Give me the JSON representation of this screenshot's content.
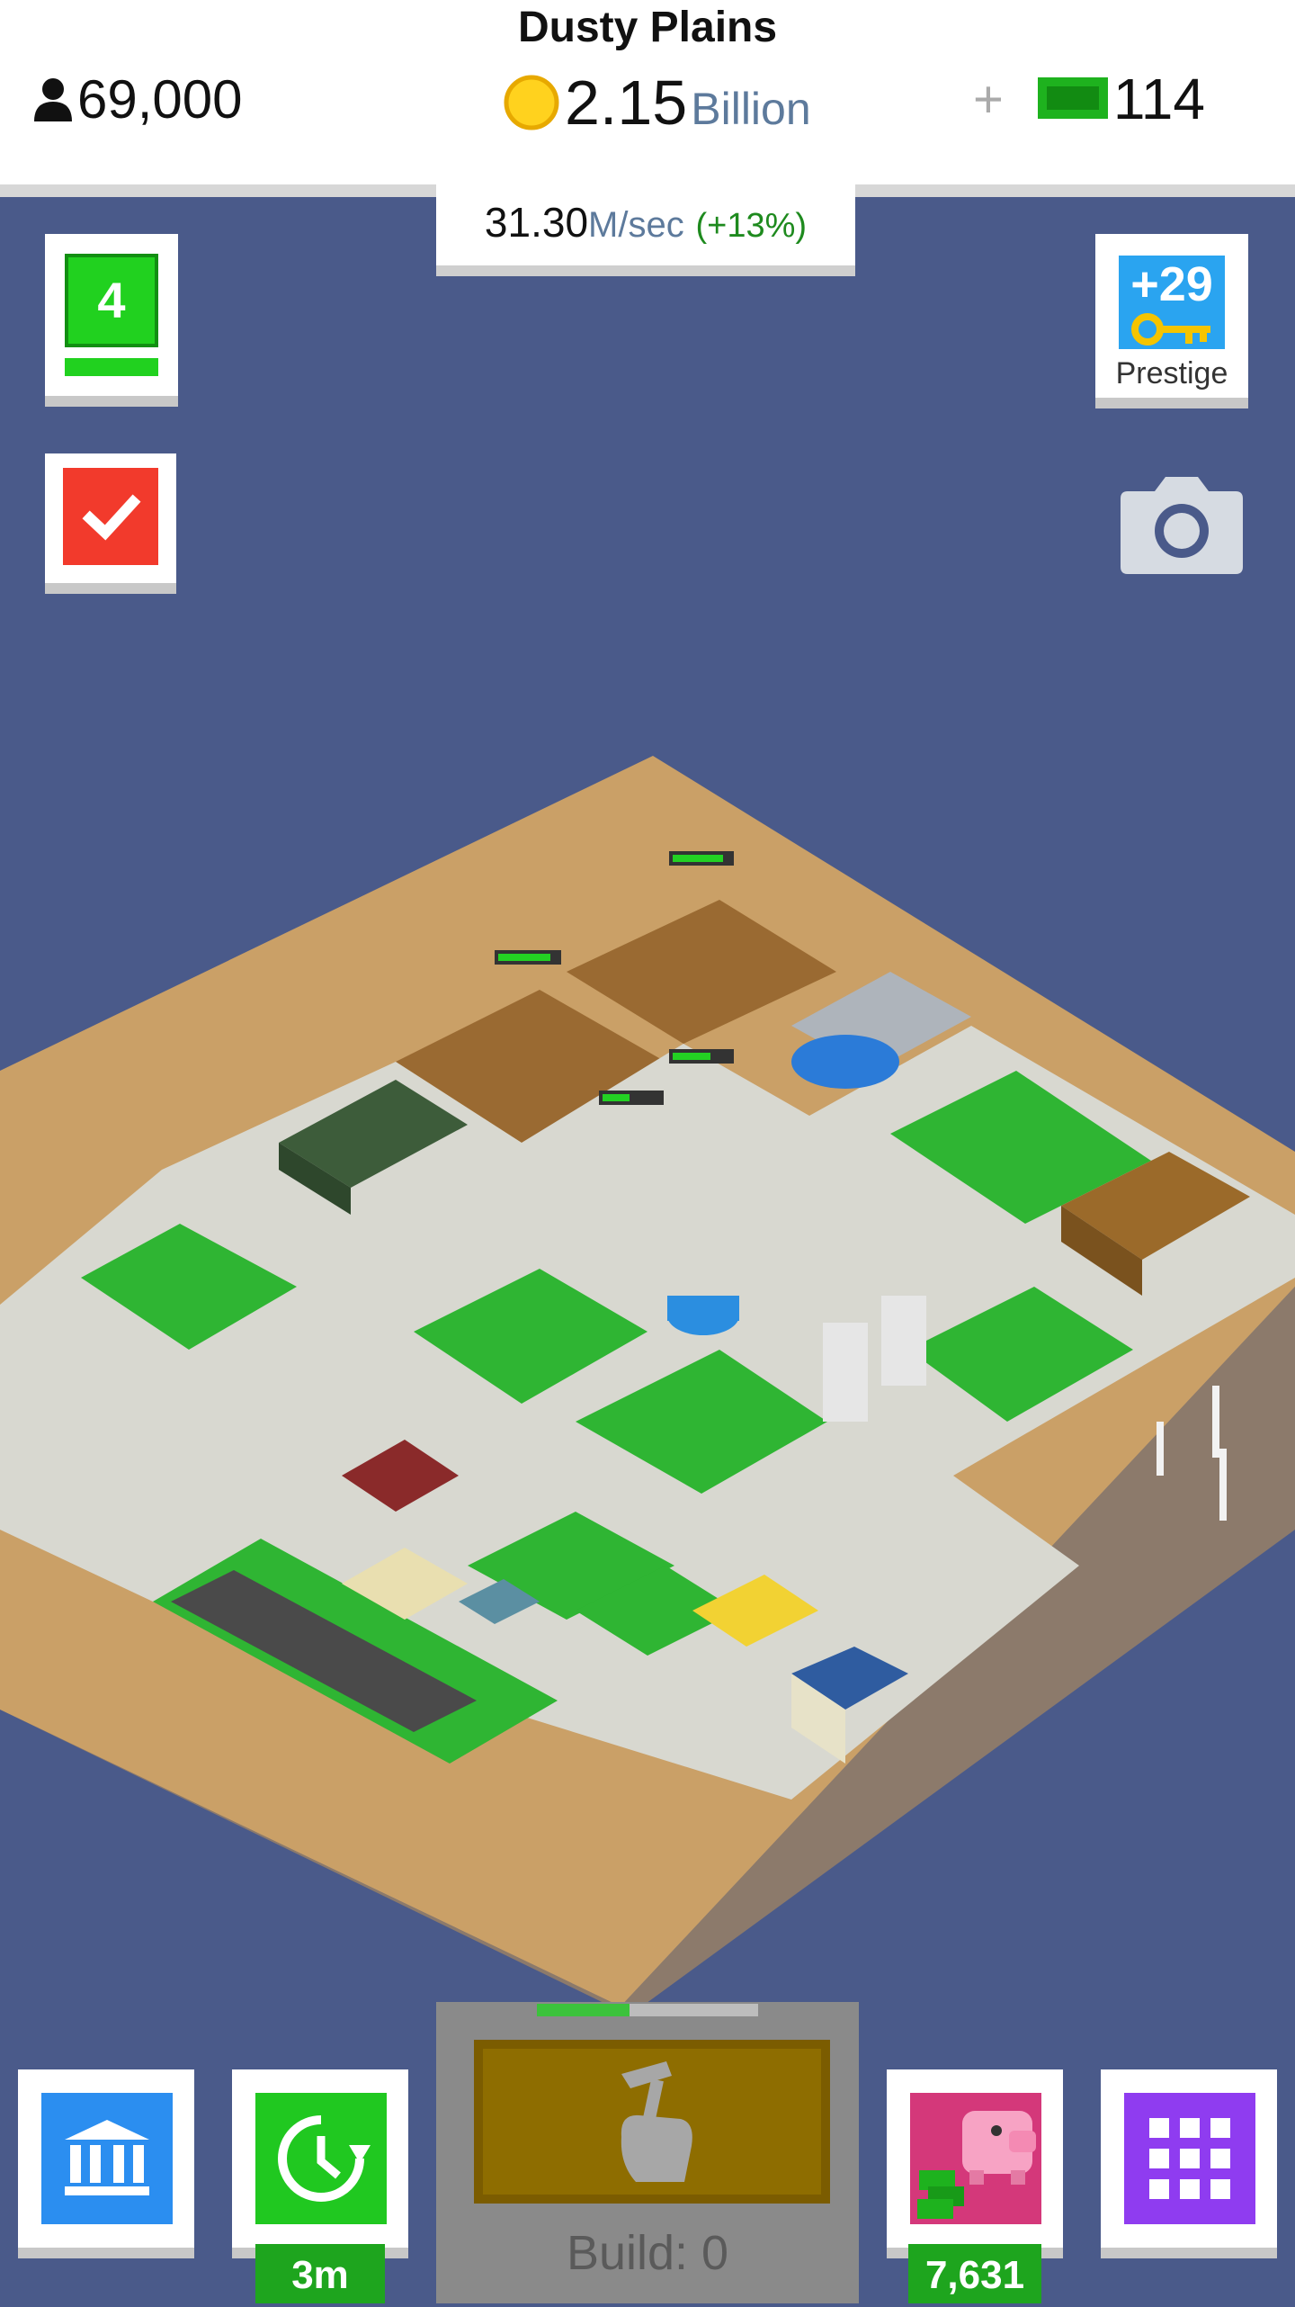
{
  "header": {
    "city_name": "Dusty Plains",
    "population": "69,000",
    "money_value": "2.15",
    "money_unit": "Billion",
    "cash_plus": "+",
    "cash_count": "114"
  },
  "income": {
    "rate_value": "31.30",
    "rate_unit": "M/sec",
    "rate_bonus": "(+13%)"
  },
  "left_panel": {
    "level": "4"
  },
  "right_panel": {
    "prestige_count": "+29",
    "prestige_label": "Prestige"
  },
  "bottom_bar": {
    "boost_timer": "3m",
    "build_label": "Build: 0",
    "build_progress": 0.42,
    "piggy_bank_count": "7,631"
  },
  "colors": {
    "sky": "#4a5a8a",
    "sand": "#caa067",
    "road": "#d8d8d0",
    "grass": "#2fb533",
    "dirt": "#9a6a32"
  },
  "icons": [
    "person-icon",
    "coin-icon",
    "cash-icon",
    "checkmark-icon",
    "key-icon",
    "camera-icon",
    "bank-icon",
    "clock-boost-icon",
    "hammer-hand-icon",
    "piggy-bank-icon",
    "grid-menu-icon"
  ]
}
